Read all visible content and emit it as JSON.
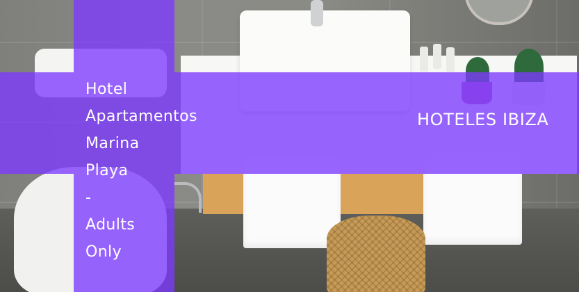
{
  "hotel": {
    "name_lines": [
      "Hotel",
      "Apartamentos",
      "Marina",
      "Playa",
      "-",
      "Adults",
      "Only"
    ]
  },
  "category": "HOTELES IBIZA",
  "overlay_color": "#7c3aff"
}
